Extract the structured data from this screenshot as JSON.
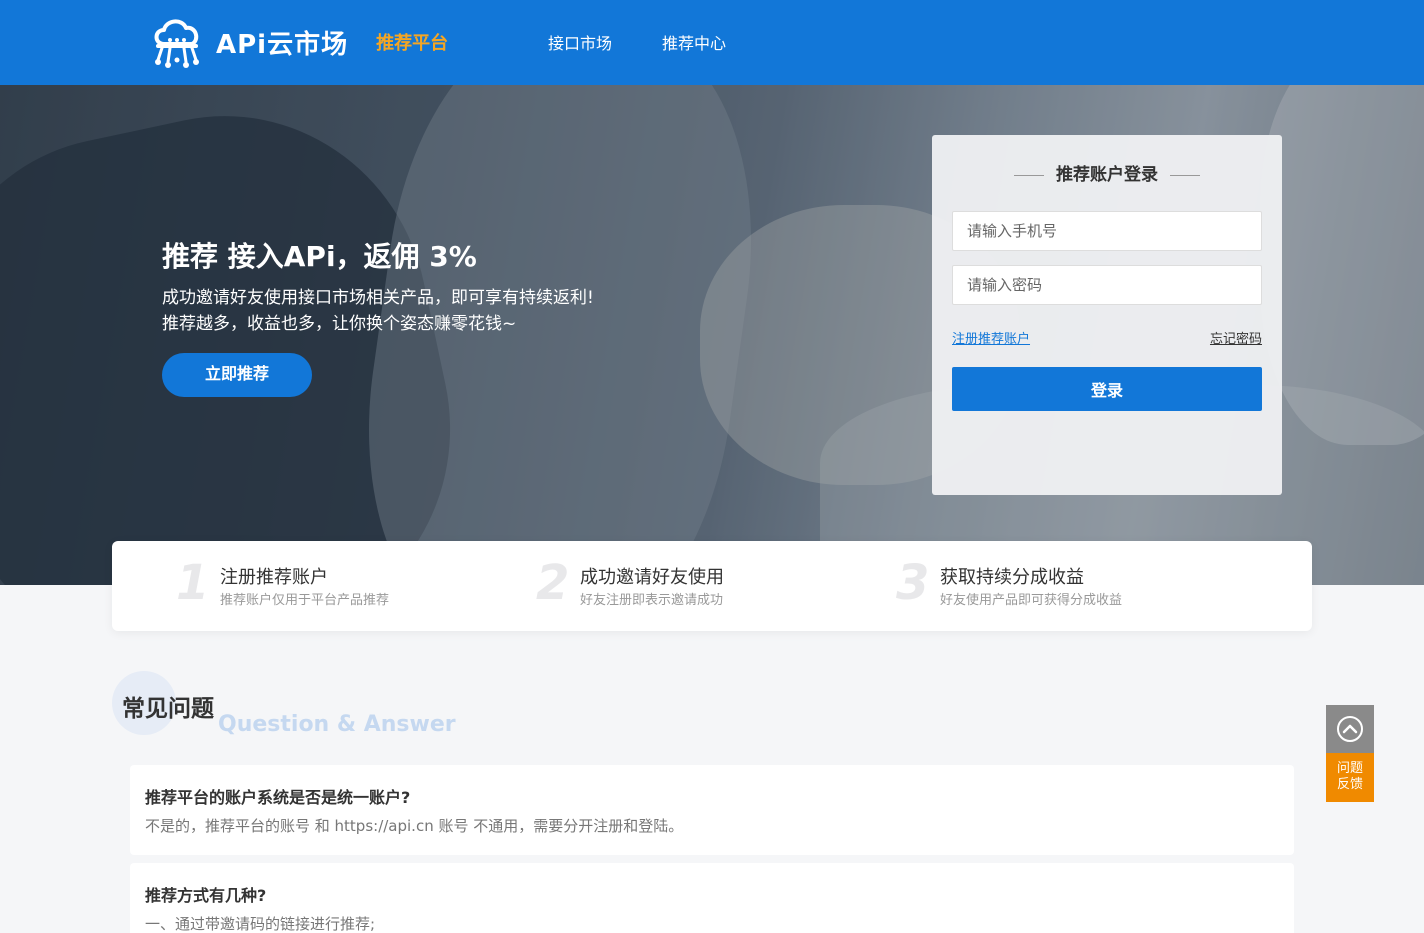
{
  "header": {
    "logo_text": "APi云市场",
    "logo_sub": "推荐平台",
    "nav": [
      "接口市场",
      "推荐中心"
    ]
  },
  "hero": {
    "title": "推荐 接入APi，返佣 3%",
    "line1": "成功邀请好友使用接口市场相关产品，即可享有持续返利!",
    "line2": "推荐越多，收益也多，让你换个姿态赚零花钱~",
    "button": "立即推荐"
  },
  "login": {
    "title": "推荐账户登录",
    "phone_placeholder": "请输入手机号",
    "password_placeholder": "请输入密码",
    "register_link": "注册推荐账户",
    "forgot_link": "忘记密码",
    "submit": "登录"
  },
  "steps": [
    {
      "num": "1",
      "title": "注册推荐账户",
      "desc": "推荐账户仅用于平台产品推荐"
    },
    {
      "num": "2",
      "title": "成功邀请好友使用",
      "desc": "好友注册即表示邀请成功"
    },
    {
      "num": "3",
      "title": "获取持续分成收益",
      "desc": "好友使用产品即可获得分成收益"
    }
  ],
  "faq": {
    "title": "常见问题",
    "subtitle": "Question & Answer",
    "items": [
      {
        "q": "推荐平台的账户系统是否是统一账户?",
        "a": "不是的，推荐平台的账号 和 https://api.cn 账号 不通用，需要分开注册和登陆。"
      },
      {
        "q": "推荐方式有几种?",
        "a": "一、通过带邀请码的链接进行推荐;"
      }
    ]
  },
  "float": {
    "feedback": [
      "问题",
      "反馈"
    ]
  },
  "colors": {
    "primary": "#1277d8",
    "accent": "#f5a623",
    "feedback": "#f08a00"
  }
}
